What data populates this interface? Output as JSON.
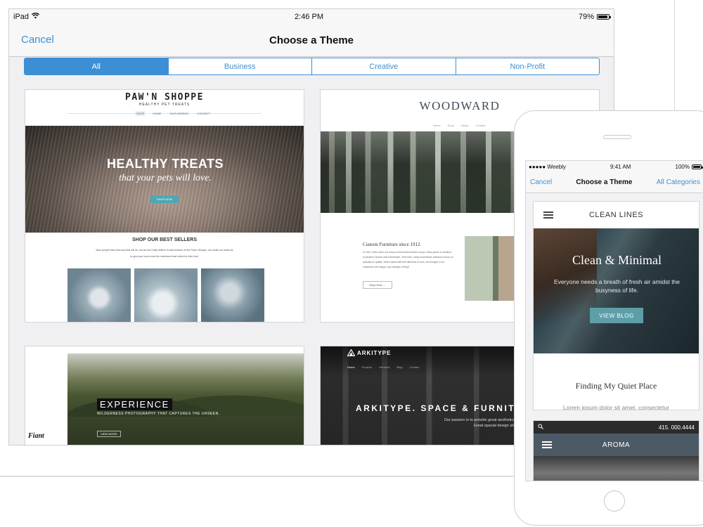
{
  "tablet": {
    "status": {
      "device": "iPad",
      "time": "2:46 PM",
      "battery": "79%",
      "battery_level": 0.79
    },
    "nav": {
      "cancel_label": "Cancel",
      "title": "Choose a Theme"
    },
    "tabs": [
      {
        "label": "All",
        "active": true
      },
      {
        "label": "Business",
        "active": false
      },
      {
        "label": "Creative",
        "active": false
      },
      {
        "label": "Non-Profit",
        "active": false
      }
    ],
    "themes": {
      "pawn_shoppe": {
        "brand": "PAW'N SHOPPE",
        "tagline": "HEALTHY PET TREATS",
        "hero_title": "HEALTHY TREATS",
        "hero_subtitle": "that your pets will love.",
        "hero_button": "SHOP NOW",
        "section_title": "SHOP OUR BEST SELLERS"
      },
      "woodward": {
        "brand": "WOODWARD",
        "subtitle": "Custom Furniture since 1912.",
        "button": "Shop Now"
      },
      "experience": {
        "title": "EXPERIENCE",
        "subtitle": "WILDERNESS PHOTOGRAPHY THAT CAPTURES THE UNSEEN.",
        "button": "VIEW WORK",
        "logo": "Fiant"
      },
      "arkitype": {
        "logo": "ARKITYPE",
        "menu": [
          "Home",
          "Projects",
          "Services",
          "Blog",
          "Contact"
        ],
        "headline": "ARKITYPE. SPACE & FURNITURE",
        "subline_1": "Our passion is to provide great aesthetics to varied spaces.",
        "subline_2": "Great spacial design should go unnoticed."
      }
    }
  },
  "phone": {
    "status": {
      "carrier": "●●●●● Weebly",
      "time": "9:41 AM",
      "battery": "100%"
    },
    "nav": {
      "cancel_label": "Cancel",
      "title": "Choose a Theme",
      "categories_label": "All Categories"
    },
    "clean_lines": {
      "name": "CLEAN LINES",
      "hero_title": "Clean & Minimal",
      "hero_subtitle": "Everyone needs a breath of fresh air amidst the busyness of life.",
      "hero_button": "VIEW BLOG",
      "body_title": "Finding My Quiet Place",
      "body_text": "Lorem ipsum dolor sit amet, consectetur"
    },
    "aroma": {
      "phone_number": "415. 000.4444",
      "name": "AROMA"
    }
  },
  "icons": [
    "wifi-icon",
    "battery-icon",
    "menu-icon",
    "search-icon",
    "arkitype-logo-icon"
  ]
}
